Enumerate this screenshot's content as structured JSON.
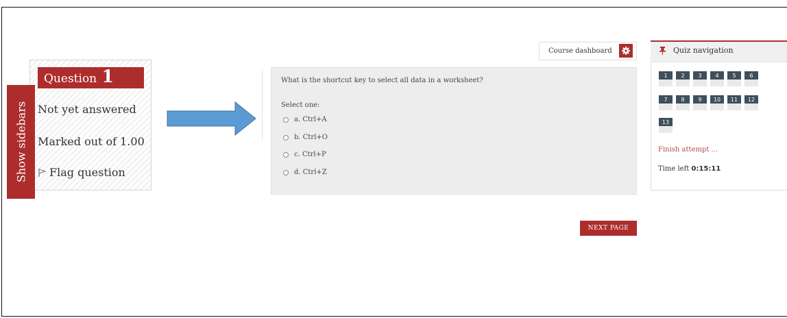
{
  "question_info": {
    "label": "Question",
    "number": "1",
    "status": "Not yet answered",
    "marks": "Marked out of 1.00",
    "flag_label": "Flag question"
  },
  "sidebar_tab": {
    "label": "Show sidebars"
  },
  "header": {
    "course_dashboard": "Course dashboard"
  },
  "question": {
    "text": "What is the shortcut key to select all data in a worksheet?",
    "prompt": "Select one:",
    "options": [
      "a. Ctrl+A",
      "b. Ctrl+O",
      "c. Ctrl+P",
      "d. Ctrl+Z"
    ]
  },
  "next_button": {
    "label": "NEXT PAGE"
  },
  "quiz_nav": {
    "title": "Quiz navigation",
    "buttons": [
      "1",
      "2",
      "3",
      "4",
      "5",
      "6",
      "7",
      "8",
      "9",
      "10",
      "11",
      "12",
      "13"
    ],
    "finish_label": "Finish attempt ...",
    "time_label": "Time left",
    "time_value": "0:15:11"
  },
  "colors": {
    "accent": "#ad2d2d",
    "nav_button": "#3f4f5b",
    "arrow": "#5b9bd5"
  },
  "icons": {
    "gear": "gear-icon",
    "pin": "pin-icon",
    "flag": "flag-icon",
    "arrow": "right-arrow-icon"
  }
}
